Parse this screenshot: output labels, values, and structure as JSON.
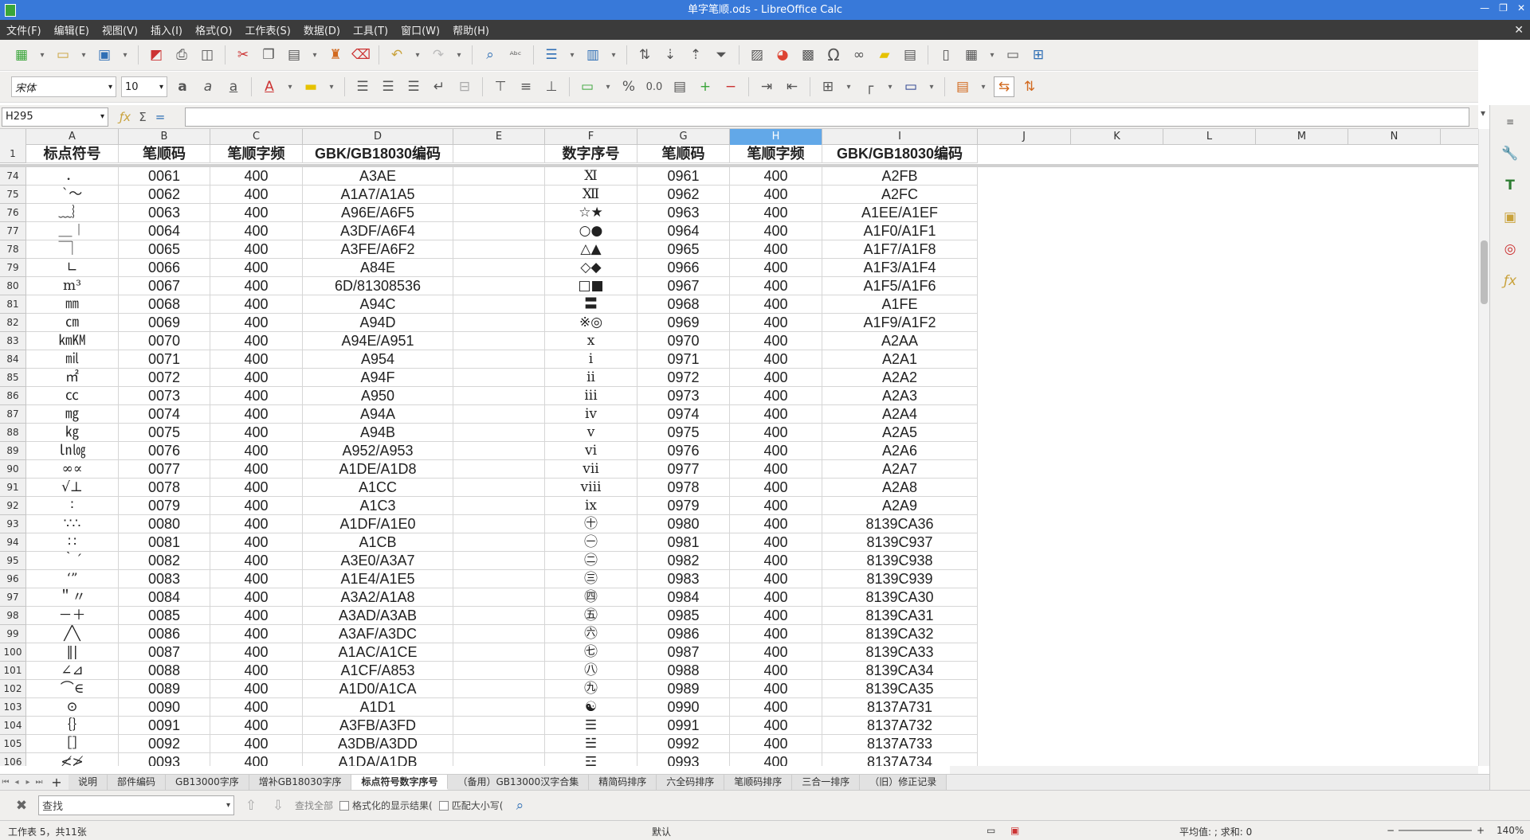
{
  "window": {
    "title": "单字笔顺.ods - LibreOffice Calc",
    "min": "—",
    "restore": "❐",
    "close": "✕"
  },
  "menu": [
    "文件(F)",
    "编辑(E)",
    "视图(V)",
    "插入(I)",
    "格式(O)",
    "工作表(S)",
    "数据(D)",
    "工具(T)",
    "窗口(W)",
    "帮助(H)"
  ],
  "font": {
    "name": "宋体",
    "size": "10"
  },
  "formula": {
    "cell_ref": "H295",
    "value": ""
  },
  "columns": [
    "A",
    "B",
    "C",
    "D",
    "E",
    "F",
    "G",
    "H",
    "I",
    "J",
    "K",
    "L",
    "M",
    "N"
  ],
  "selected_column": "H",
  "header_row": {
    "num": "1",
    "cells": [
      "标点符号",
      "笔顺码",
      "笔顺字频",
      "GBK/GB18030编码",
      "",
      "数字序号",
      "笔顺码",
      "笔顺字频",
      "GBK/GB18030编码",
      "",
      "",
      "",
      "",
      ""
    ]
  },
  "rows": [
    [
      "74",
      "．",
      "0061",
      "400",
      "A3AE",
      "",
      "Ⅺ",
      "0961",
      "400",
      "A2FB"
    ],
    [
      "75",
      "ˋ～",
      "0062",
      "400",
      "A1A7/A1A5",
      "",
      "Ⅻ",
      "0962",
      "400",
      "A2FC"
    ],
    [
      "76",
      "﹏︴",
      "0063",
      "400",
      "A96E/A6F5",
      "",
      "☆★",
      "0963",
      "400",
      "A1EE/A1EF"
    ],
    [
      "77",
      "＿︱",
      "0064",
      "400",
      "A3DF/A6F4",
      "",
      "○●",
      "0964",
      "400",
      "A1F0/A1F1"
    ],
    [
      "78",
      "￣︳",
      "0065",
      "400",
      "A3FE/A6F2",
      "",
      "△▲",
      "0965",
      "400",
      "A1F7/A1F8"
    ],
    [
      "79",
      "∟",
      "0066",
      "400",
      "A84E",
      "",
      "◇◆",
      "0966",
      "400",
      "A1F3/A1F4"
    ],
    [
      "80",
      "m³",
      "0067",
      "400",
      "6D/81308536",
      "",
      "□■",
      "0967",
      "400",
      "A1F5/A1F6"
    ],
    [
      "81",
      "㎜",
      "0068",
      "400",
      "A94C",
      "",
      "〓",
      "0968",
      "400",
      "A1FE"
    ],
    [
      "82",
      "㎝",
      "0069",
      "400",
      "A94D",
      "",
      "※◎",
      "0969",
      "400",
      "A1F9/A1F2"
    ],
    [
      "83",
      "㎞㏎",
      "0070",
      "400",
      "A94E/A951",
      "",
      "x",
      "0970",
      "400",
      "A2AA"
    ],
    [
      "84",
      "㏕",
      "0071",
      "400",
      "A954",
      "",
      "i",
      "0971",
      "400",
      "A2A1"
    ],
    [
      "85",
      "㎡",
      "0072",
      "400",
      "A94F",
      "",
      "ii",
      "0972",
      "400",
      "A2A2"
    ],
    [
      "86",
      "㏄",
      "0073",
      "400",
      "A950",
      "",
      "iii",
      "0973",
      "400",
      "A2A3"
    ],
    [
      "87",
      "㎎",
      "0074",
      "400",
      "A94A",
      "",
      "iv",
      "0974",
      "400",
      "A2A4"
    ],
    [
      "88",
      "㎏",
      "0075",
      "400",
      "A94B",
      "",
      "v",
      "0975",
      "400",
      "A2A5"
    ],
    [
      "89",
      "㏑㏒",
      "0076",
      "400",
      "A952/A953",
      "",
      "vi",
      "0976",
      "400",
      "A2A6"
    ],
    [
      "90",
      "∞∝",
      "0077",
      "400",
      "A1DE/A1D8",
      "",
      "vii",
      "0977",
      "400",
      "A2A7"
    ],
    [
      "91",
      "√⊥",
      "0078",
      "400",
      "A1CC",
      "",
      "viii",
      "0978",
      "400",
      "A2A8"
    ],
    [
      "92",
      "∶",
      "0079",
      "400",
      "A1C3",
      "",
      "ix",
      "0979",
      "400",
      "A2A9"
    ],
    [
      "93",
      "∵∴",
      "0080",
      "400",
      "A1DF/A1E0",
      "",
      "㊉",
      "0980",
      "400",
      "8139CA36"
    ],
    [
      "94",
      "∷",
      "0081",
      "400",
      "A1CB",
      "",
      "㊀",
      "0981",
      "400",
      "8139C937"
    ],
    [
      "95",
      "｀ˊ",
      "0082",
      "400",
      "A3E0/A3A7",
      "",
      "㊁",
      "0982",
      "400",
      "8139C938"
    ],
    [
      "96",
      "‘”",
      "0083",
      "400",
      "A1E4/A1E5",
      "",
      "㊂",
      "0983",
      "400",
      "8139C939"
    ],
    [
      "97",
      "＂〃",
      "0084",
      "400",
      "A3A2/A1A8",
      "",
      "㊃",
      "0984",
      "400",
      "8139CA30"
    ],
    [
      "98",
      "－＋",
      "0085",
      "400",
      "A3AD/A3AB",
      "",
      "㊄",
      "0985",
      "400",
      "8139CA31"
    ],
    [
      "99",
      "╱╲",
      "0086",
      "400",
      "A3AF/A3DC",
      "",
      "㊅",
      "0986",
      "400",
      "8139CA32"
    ],
    [
      "100",
      "‖|",
      "0087",
      "400",
      "A1AC/A1CE",
      "",
      "㊆",
      "0987",
      "400",
      "8139CA33"
    ],
    [
      "101",
      "∠⊿",
      "0088",
      "400",
      "A1CF/A853",
      "",
      "㊇",
      "0988",
      "400",
      "8139CA34"
    ],
    [
      "102",
      "⌒∈",
      "0089",
      "400",
      "A1D0/A1CA",
      "",
      "㊈",
      "0989",
      "400",
      "8139CA35"
    ],
    [
      "103",
      "⊙",
      "0090",
      "400",
      "A1D1",
      "",
      "☯",
      "0990",
      "400",
      "8137A731"
    ],
    [
      "104",
      "｛｝",
      "0091",
      "400",
      "A3FB/A3FD",
      "",
      "☰",
      "0991",
      "400",
      "8137A732"
    ],
    [
      "105",
      "［］",
      "0092",
      "400",
      "A3DB/A3DD",
      "",
      "☱",
      "0992",
      "400",
      "8137A733"
    ],
    [
      "106",
      "≮≯",
      "0093",
      "400",
      "A1DA/A1DB",
      "",
      "☲",
      "0993",
      "400",
      "8137A734"
    ]
  ],
  "tabs": [
    "说明",
    "部件编码",
    "GB13000字序",
    "增补GB18030字序",
    "标点符号数字序号",
    "（备用）GB13000汉字合集",
    "精简码排序",
    "六全码排序",
    "笔顺码排序",
    "三合一排序",
    "（旧）修正记录"
  ],
  "active_tab": "标点符号数字序号",
  "find": {
    "placeholder": "查找",
    "find_all": "查找全部",
    "formatted": "格式化的显示结果(",
    "match_case": "匹配大小写("
  },
  "status": {
    "sheet": "工作表 5，共11张",
    "style": "默认",
    "sum": "平均值: ; 求和: 0",
    "zoom": "140%"
  }
}
